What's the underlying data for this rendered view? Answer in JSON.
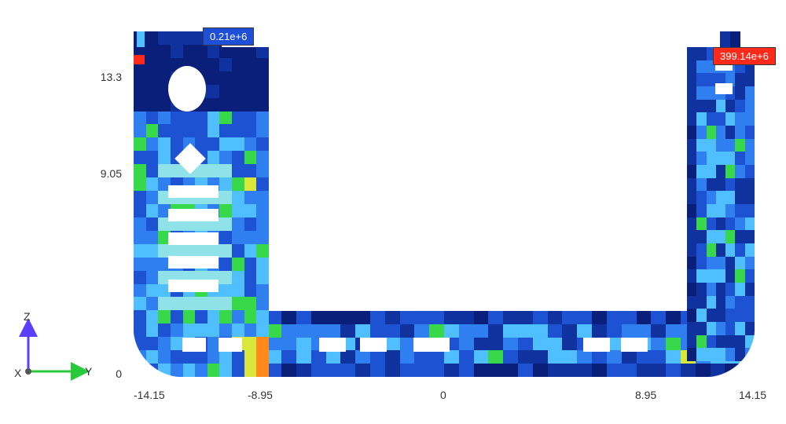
{
  "chart_data": {
    "type": "heatmap",
    "title": "",
    "xlabel": "",
    "ylabel": "",
    "x_ticks": [
      -14.15,
      -8.95,
      0,
      8.95,
      14.15
    ],
    "y_ticks": [
      0,
      9.05,
      13.3
    ],
    "xlim": [
      -14.15,
      14.15
    ],
    "ylim": [
      0,
      15.2
    ],
    "value_min_label": "0.21e+6",
    "value_max_label": "399.14e+6",
    "value_min": 210000.0,
    "value_max": 399140000.0,
    "palette": [
      "#ffffff",
      "#0a1f7a",
      "#10329e",
      "#1d52d2",
      "#2f7ff0",
      "#4fbfff",
      "#8fe3e8",
      "#37d84a",
      "#d9e63a",
      "#ff8a1a",
      "#ff2a1a"
    ],
    "triad": {
      "axes": [
        "X",
        "Y",
        "Z"
      ],
      "colors": {
        "X": "#555555",
        "Y": "#28c93a",
        "Z": "#5a3fff"
      }
    },
    "regions": [
      {
        "name": "left_wall",
        "x_cells": 11,
        "y_cells": 26,
        "x_range": [
          -14.15,
          -8.95
        ],
        "y_range": [
          0,
          15.2
        ],
        "comment": "tall left structure with cutouts"
      },
      {
        "name": "bottom",
        "x_cells": 42,
        "y_cells": 5,
        "x_range": [
          -14.15,
          14.15
        ],
        "y_range": [
          0,
          2.7
        ],
        "comment": "bottom slab"
      },
      {
        "name": "right_wall",
        "x_cells": 7,
        "y_cells": 24,
        "x_range": [
          11.5,
          14.15
        ],
        "y_range": [
          2.0,
          15.0
        ],
        "comment": "thin right column"
      }
    ],
    "annotations": [
      {
        "type": "min",
        "text": "0.21e+6",
        "approx_xy": [
          -10.3,
          15.1
        ]
      },
      {
        "type": "max",
        "text": "399.14e+6",
        "approx_xy": [
          13.7,
          14.0
        ]
      }
    ]
  },
  "ticks": {
    "x": [
      "-14.15",
      "-8.95",
      "0",
      "8.95",
      "14.15"
    ],
    "y": [
      "13.3",
      "9.05",
      "0"
    ]
  },
  "labels": {
    "min": "0.21e+6",
    "max": "399.14e+6",
    "X": "X",
    "Y": "Y",
    "Z": "Z"
  }
}
